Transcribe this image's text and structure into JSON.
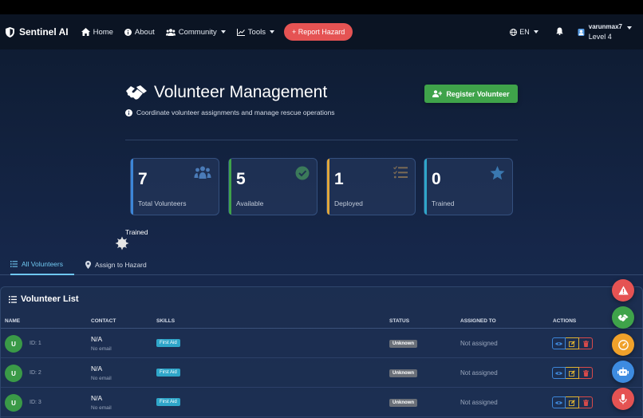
{
  "navbar": {
    "brand": "Sentinel AI",
    "links": {
      "home": "Home",
      "about": "About",
      "community": "Community",
      "tools": "Tools"
    },
    "report_label": "+ Report Hazard",
    "language": "EN",
    "user": {
      "name": "varunmax7",
      "level": "Level 4"
    }
  },
  "hero": {
    "title": "Volunteer Management",
    "subtitle": "Coordinate volunteer assignments and manage rescue operations",
    "register_label": "Register Volunteer"
  },
  "stats": [
    {
      "value": "7",
      "label": "Total Volunteers",
      "color": "#3d86d8",
      "icon": "users-icon"
    },
    {
      "value": "5",
      "label": "Available",
      "color": "#3fa34a",
      "icon": "check-circle-icon"
    },
    {
      "value": "1",
      "label": "Deployed",
      "color": "#e0a63a",
      "icon": "tasks-icon"
    },
    {
      "value": "0",
      "label": "Trained",
      "color": "#2fa6c9",
      "icon": "star-icon"
    }
  ],
  "floating_label": "Trained",
  "tabs": {
    "all": "All Volunteers",
    "assign": "Assign to Hazard"
  },
  "list": {
    "title": "Volunteer List",
    "columns": {
      "name": "NAME",
      "contact": "CONTACT",
      "skills": "SKILLS",
      "status": "STATUS",
      "assigned": "ASSIGNED TO",
      "actions": "ACTIONS"
    },
    "rows": [
      {
        "initial": "U",
        "id": "ID: 1",
        "contact": "N/A",
        "email": "No email",
        "skill": "First Aid",
        "status": "Unknown",
        "assigned": "Not assigned"
      },
      {
        "initial": "U",
        "id": "ID: 2",
        "contact": "N/A",
        "email": "No email",
        "skill": "First Aid",
        "status": "Unknown",
        "assigned": "Not assigned"
      },
      {
        "initial": "U",
        "id": "ID: 3",
        "contact": "N/A",
        "email": "No email",
        "skill": "First Aid",
        "status": "Unknown",
        "assigned": "Not assigned"
      }
    ]
  },
  "fabs": [
    {
      "icon": "warning-icon",
      "color": "#e55353"
    },
    {
      "icon": "handshake-icon",
      "color": "#3fa34a"
    },
    {
      "icon": "gauge-icon",
      "color": "#f0a12a"
    },
    {
      "icon": "robot-icon",
      "color": "#3d8be0"
    },
    {
      "icon": "microphone-icon",
      "color": "#e55353"
    }
  ],
  "colors": {
    "accent": "#6fc7f0",
    "success": "#3fa34a",
    "danger": "#e55353",
    "navbar": "#0b1423"
  }
}
